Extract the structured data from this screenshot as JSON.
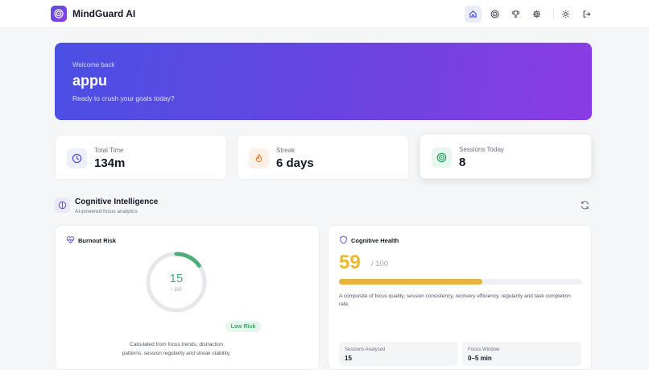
{
  "app": {
    "title": "MindGuard AI"
  },
  "hero": {
    "welcome": "Welcome back",
    "user": "appu",
    "tagline": "Ready to crush your goals today?"
  },
  "stats": [
    {
      "label": "Total Time",
      "value": "134m",
      "icon": "clock-icon"
    },
    {
      "label": "Streak",
      "value": "6 days",
      "icon": "flame-icon"
    },
    {
      "label": "Sessions Today",
      "value": "8",
      "icon": "target-icon"
    }
  ],
  "section": {
    "title": "Cognitive Intelligence",
    "subtitle": "AI-powered focus analytics"
  },
  "burnout": {
    "title": "Burnout Risk",
    "value": "15",
    "max": "/ 100",
    "fraction": 0.15,
    "badge": "Low Risk",
    "description": "Calculated from focus trends, distraction patterns, session regularity and streak stability."
  },
  "health": {
    "title": "Cognitive Health",
    "value": "59",
    "max": "/ 100",
    "fraction": 0.59,
    "description": "A composite of focus quality, session consistency, recovery efficiency, regularity and task completion rate.",
    "minis": [
      {
        "label": "Sessions Analysed",
        "value": "15"
      },
      {
        "label": "Focus Window",
        "value": "0–5 min"
      }
    ]
  },
  "colors": {
    "accent": "#5b4de0",
    "burnout_ring": "#4caf7a",
    "health_bar": "#e6b43c"
  }
}
